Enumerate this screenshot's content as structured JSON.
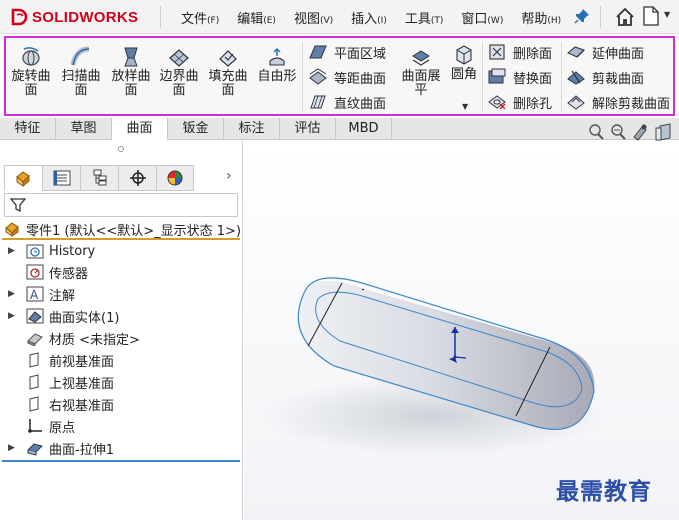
{
  "app": {
    "logo_ds": "DS",
    "logo_text": "SOLIDWORKS"
  },
  "menu": [
    {
      "label": "文件",
      "key": "(F)"
    },
    {
      "label": "编辑",
      "key": "(E)"
    },
    {
      "label": "视图",
      "key": "(V)"
    },
    {
      "label": "插入",
      "key": "(I)"
    },
    {
      "label": "工具",
      "key": "(T)"
    },
    {
      "label": "窗口",
      "key": "(W)"
    },
    {
      "label": "帮助",
      "key": "(H)"
    }
  ],
  "ribbon": {
    "big_tools": [
      {
        "label": "旋转曲\n面",
        "icon": "revolve-surface-icon"
      },
      {
        "label": "扫描曲\n面",
        "icon": "sweep-surface-icon"
      },
      {
        "label": "放样曲\n面",
        "icon": "loft-surface-icon"
      },
      {
        "label": "边界曲\n面",
        "icon": "boundary-surface-icon"
      },
      {
        "label": "填充曲\n面",
        "icon": "fill-surface-icon"
      },
      {
        "label": "自由形",
        "icon": "freeform-icon"
      }
    ],
    "col1": [
      {
        "label": "平面区域",
        "icon": "planar-surface-icon"
      },
      {
        "label": "等距曲面",
        "icon": "offset-surface-icon"
      },
      {
        "label": "直纹曲面",
        "icon": "ruled-surface-icon"
      }
    ],
    "flatten": {
      "label": "曲面展\n平",
      "icon": "surface-flatten-icon"
    },
    "fillet": {
      "label": "圆角",
      "icon": "fillet-icon"
    },
    "col2": [
      {
        "label": "删除面",
        "icon": "delete-face-icon"
      },
      {
        "label": "替换面",
        "icon": "replace-face-icon"
      },
      {
        "label": "删除孔",
        "icon": "delete-hole-icon"
      }
    ],
    "col3": [
      {
        "label": "延伸曲面",
        "icon": "extend-surface-icon"
      },
      {
        "label": "剪裁曲面",
        "icon": "trim-surface-icon"
      },
      {
        "label": "解除剪裁曲面",
        "icon": "untrim-surface-icon"
      }
    ]
  },
  "tabs": [
    {
      "label": "特征"
    },
    {
      "label": "草图"
    },
    {
      "label": "曲面",
      "active": true
    },
    {
      "label": "钣金"
    },
    {
      "label": "标注"
    },
    {
      "label": "评估"
    },
    {
      "label": "MBD"
    }
  ],
  "tree": {
    "root": "零件1 (默认<<默认>_显示状态 1>)",
    "nodes": [
      {
        "label": "History",
        "expand": true,
        "icon": "history-folder-icon"
      },
      {
        "label": "传感器",
        "expand": false,
        "icon": "sensor-icon"
      },
      {
        "label": "注解",
        "expand": true,
        "icon": "annotation-icon"
      },
      {
        "label": "曲面实体(1)",
        "expand": true,
        "icon": "surface-body-icon"
      },
      {
        "label": "材质 <未指定>",
        "expand": false,
        "icon": "material-icon"
      },
      {
        "label": "前视基准面",
        "expand": false,
        "icon": "plane-icon"
      },
      {
        "label": "上视基准面",
        "expand": false,
        "icon": "plane-icon"
      },
      {
        "label": "右视基准面",
        "expand": false,
        "icon": "plane-icon"
      },
      {
        "label": "原点",
        "expand": false,
        "icon": "origin-icon"
      },
      {
        "label": "曲面-拉伸1",
        "expand": true,
        "icon": "surface-extrude-icon"
      }
    ]
  },
  "watermark": "最需教育",
  "colors": {
    "highlight": "#d22bd2",
    "brand": "#d0021b",
    "accent": "#3f86c8"
  }
}
